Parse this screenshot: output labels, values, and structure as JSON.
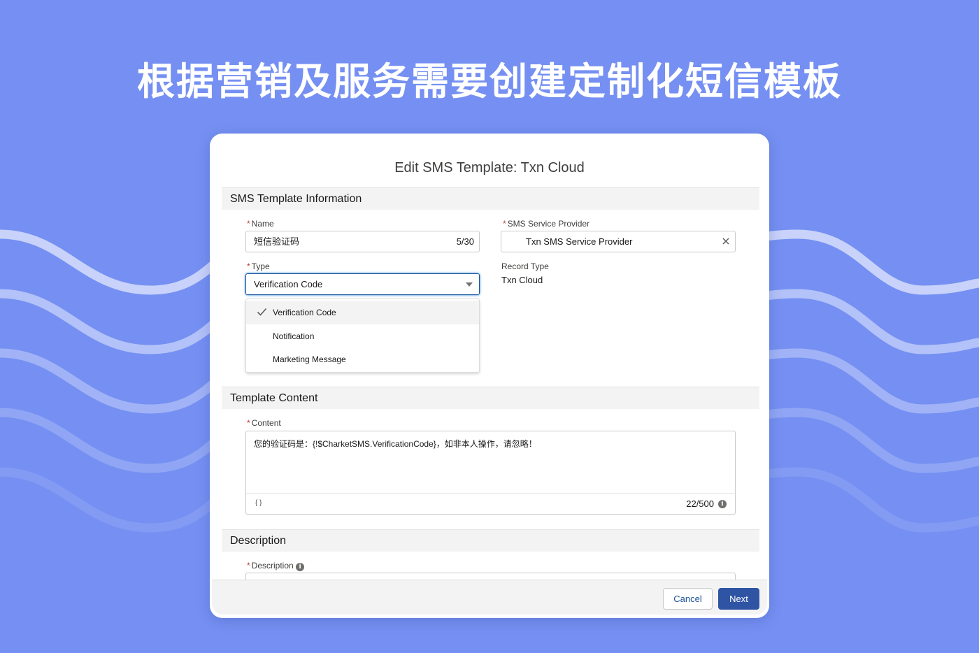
{
  "hero": {
    "title": "根据营销及服务需要创建定制化短信模板"
  },
  "modal": {
    "title": "Edit SMS Template: Txn Cloud"
  },
  "sections": {
    "info": "SMS Template Information",
    "content": "Template Content",
    "description": "Description"
  },
  "fields": {
    "name": {
      "label": "Name",
      "value": "短信验证码",
      "counter": "5/30"
    },
    "provider": {
      "label": "SMS Service Provider",
      "value": "Txn SMS Service Provider"
    },
    "type": {
      "label": "Type",
      "value": "Verification Code"
    },
    "record_type": {
      "label": "Record Type",
      "value": "Txn Cloud"
    },
    "content": {
      "label": "Content",
      "value": "您的验证码是：{!$CharketSMS.VerificationCode}，如非本人操作，请忽略！",
      "merge_symbol": "{ }",
      "counter": "22/500"
    },
    "description": {
      "label": "Description"
    }
  },
  "required_marker": "*",
  "type_options": [
    "Verification Code",
    "Notification",
    "Marketing Message"
  ],
  "buttons": {
    "cancel": "Cancel",
    "next": "Next"
  },
  "colors": {
    "background": "#7590f2",
    "primary": "#2f54a3",
    "required": "#c23934"
  }
}
